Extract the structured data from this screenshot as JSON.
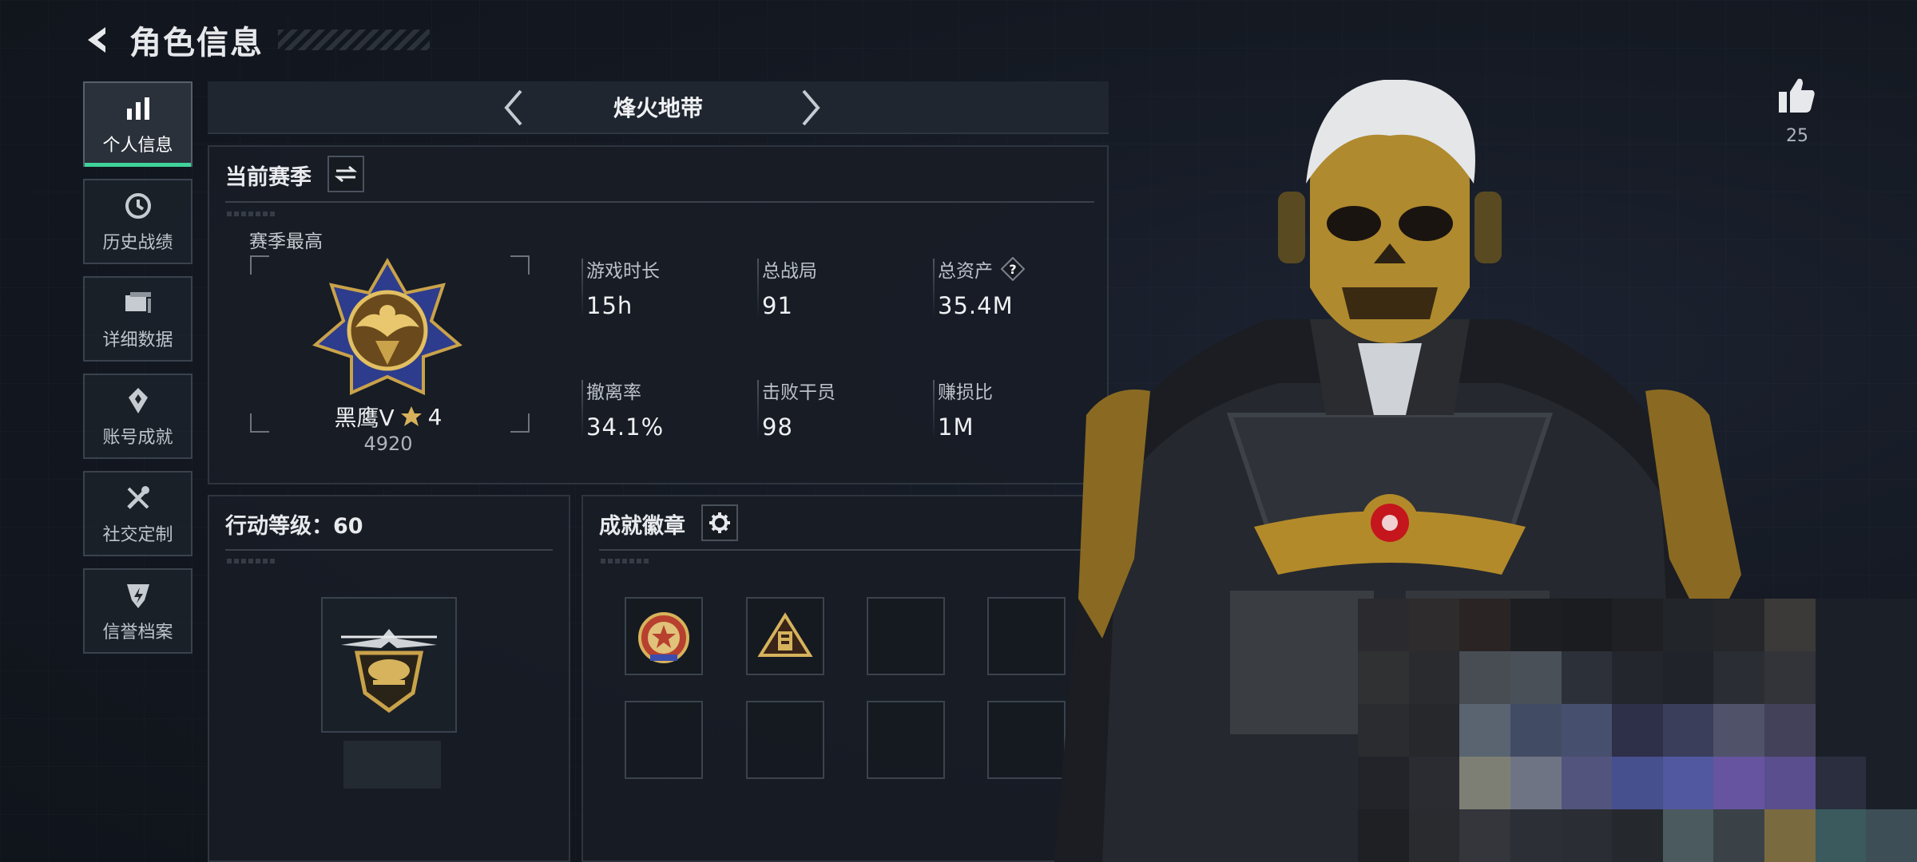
{
  "header": {
    "title": "角色信息"
  },
  "nav": {
    "items": [
      {
        "label": "个人信息",
        "icon": "bar-chart-icon",
        "active": true
      },
      {
        "label": "历史战绩",
        "icon": "history-icon",
        "active": false
      },
      {
        "label": "详细数据",
        "icon": "folder-icon",
        "active": false
      },
      {
        "label": "账号成就",
        "icon": "achievement-icon",
        "active": false
      },
      {
        "label": "社交定制",
        "icon": "tools-icon",
        "active": false
      },
      {
        "label": "信誉档案",
        "icon": "reputation-icon",
        "active": false
      }
    ]
  },
  "mode": {
    "title": "烽火地带"
  },
  "season": {
    "title": "当前赛季",
    "best_label": "赛季最高",
    "rank_name": "黑鹰V",
    "rank_stars": "4",
    "rank_score": "4920",
    "stats": [
      {
        "label": "游戏时长",
        "value": "15h"
      },
      {
        "label": "总战局",
        "value": "91"
      },
      {
        "label": "总资产",
        "value": "35.4M",
        "help": "?"
      },
      {
        "label": "撤离率",
        "value": "34.1%"
      },
      {
        "label": "击败干员",
        "value": "98"
      },
      {
        "label": "赚损比",
        "value": "1M"
      }
    ]
  },
  "action_level": {
    "title": "行动等级：60"
  },
  "badges": {
    "title": "成就徽章"
  },
  "like": {
    "count": "25"
  },
  "colors": {
    "accent": "#3fd39b",
    "gold": "#c9a24a",
    "panel": "#181d25"
  }
}
